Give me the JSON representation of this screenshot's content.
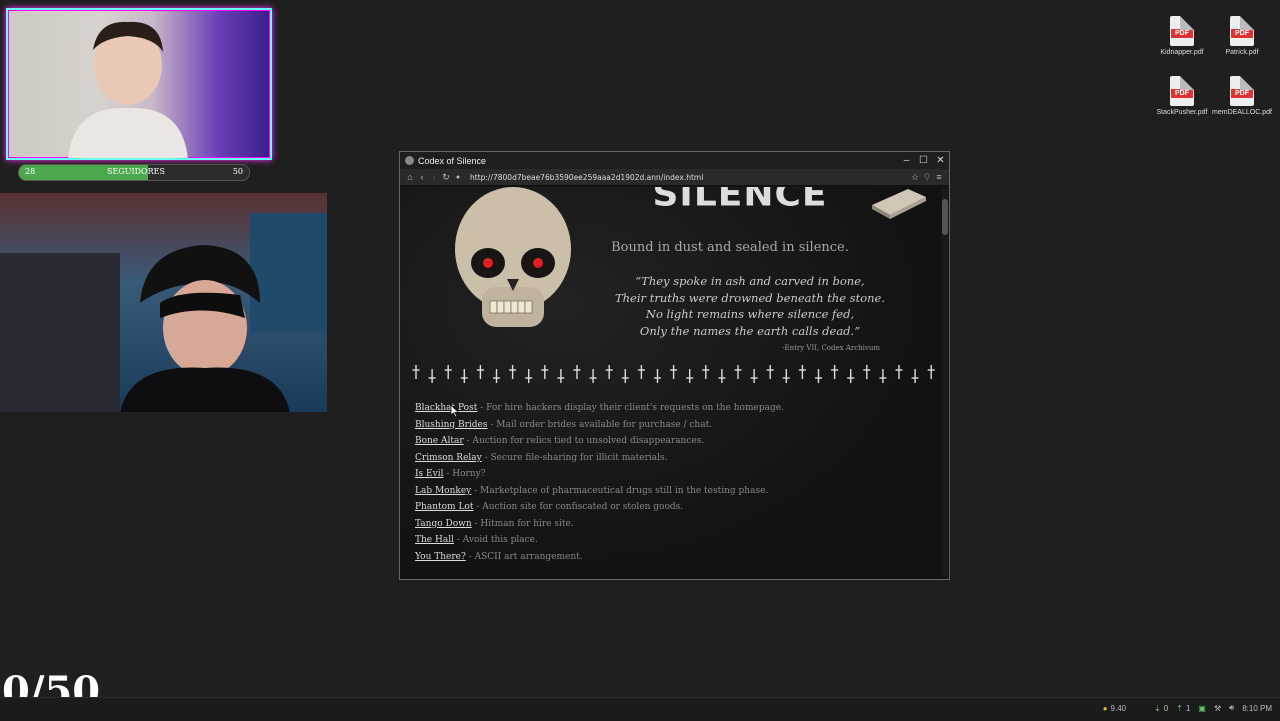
{
  "overlay": {
    "followers": {
      "current": "28",
      "label": "SEGUIDORES",
      "goal": "50",
      "progress": 0.56
    },
    "counter": "0/50"
  },
  "desktop": {
    "icons": [
      {
        "name": "Kidnapper.pdf",
        "tag": "PDF"
      },
      {
        "name": "Patrick.pdf",
        "tag": "PDF"
      },
      {
        "name": "StackPusher.pdf",
        "tag": "PDF"
      },
      {
        "name": "memDEALLOC.pdf",
        "tag": "PDF"
      }
    ]
  },
  "browser": {
    "title": "Codex of Silence",
    "url": "http://7800d7beae76b3590ee259aaa2d1902d.ann/index.html",
    "page": {
      "heading": "SILENCE",
      "subtitle": "Bound in dust and sealed in silence.",
      "poem": [
        "“They spoke in ash and carved in bone,",
        "Their truths were drowned beneath the stone.",
        "No light remains where silence fed,",
        "Only the names the earth calls dead.”"
      ],
      "attribution": "-Entry VII, Codex Archivum",
      "links": [
        {
          "name": "Blackhat Post",
          "desc": " - For hire hackers display their client's requests on the homepage."
        },
        {
          "name": "Blushing Brides",
          "desc": " - Mail order brides available for purchase / chat."
        },
        {
          "name": "Bone Altar",
          "desc": " - Auction for relics tied to unsolved disappearances."
        },
        {
          "name": "Crimson Relay",
          "desc": " - Secure file-sharing for illicit materials."
        },
        {
          "name": "Is Evil",
          "desc": " - Horny?"
        },
        {
          "name": "Lab Monkey",
          "desc": " - Marketplace of pharmaceutical drugs still in the testing phase."
        },
        {
          "name": "Phantom Lot",
          "desc": " - Auction site for confiscated or stolen goods."
        },
        {
          "name": "Tango Down",
          "desc": " - Hitman for hire site."
        },
        {
          "name": "The Hall",
          "desc": " - Avoid this place."
        },
        {
          "name": "You There?",
          "desc": " - ASCII art arrangement."
        }
      ]
    }
  },
  "taskbar": {
    "coins": "9.40",
    "net_down": "0",
    "net_up": "1",
    "clock": "8:10 PM"
  }
}
